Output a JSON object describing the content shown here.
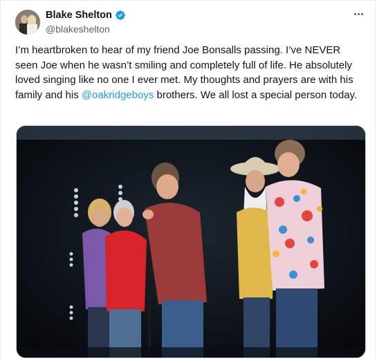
{
  "author": {
    "display_name": "Blake Shelton",
    "handle": "@blakeshelton",
    "verified": true
  },
  "tweet": {
    "text_before_mention": "I’m heartbroken to hear of my friend Joe Bonsalls passing. I’ve NEVER seen Joe when he wasn’t smiling and completely full of life. He absolutely loved singing like no one I ever met. My thoughts and prayers are with his family and his ",
    "mention": "@oakridgeboys",
    "text_after_mention": " brothers. We all lost a special person today."
  },
  "icons": {
    "verified": "verified-badge-icon",
    "more": "more-options-icon"
  },
  "colors": {
    "accent": "#1d9bf0",
    "text": "#0f1419",
    "secondary": "#536471"
  }
}
